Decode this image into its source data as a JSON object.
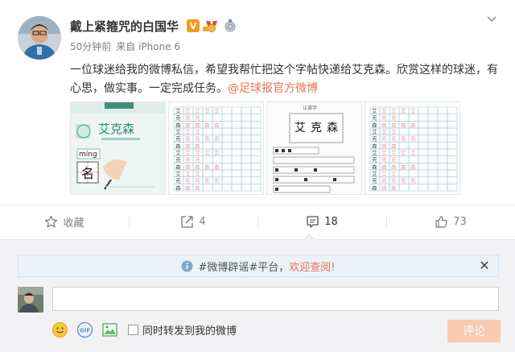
{
  "post": {
    "author": "戴上紧箍咒的白国华",
    "badges": {
      "verified": "V",
      "medal": "medal-icon",
      "coin": "coin-icon"
    },
    "time": "50分钟前",
    "source": "来自 iPhone 6",
    "text_main": "一位球迷给我的微博私信，希望我帮忙把这个字帖快递给艾克森。欣赏这样的球迷，有心思，做实事。一定完成任务。",
    "mention": "@足球报官方微博",
    "images": [
      {
        "title": "艾克森",
        "pinyin": "míng",
        "char": "名"
      },
      {
        "chars": [
          "艾",
          "克",
          "森"
        ]
      },
      {
        "heading": "认读字",
        "chars": [
          "艾",
          "克",
          "森"
        ]
      },
      {
        "chars": [
          "艾",
          "克",
          "森"
        ]
      }
    ]
  },
  "actions": {
    "favorite": "收藏",
    "repost": "4",
    "comment": "18",
    "like": "73"
  },
  "comments": {
    "notice_prefix": "#微博辟谣#平台，",
    "notice_highlight": "欢迎查阅!",
    "input_value": "",
    "repost_label": "同时转发到我的微博",
    "submit_label": "评论"
  },
  "colors": {
    "accent": "#eb7350",
    "muted": "#808080",
    "submit_disabled": "#f9c9b0",
    "notice_bg": "#ebf2fa"
  }
}
